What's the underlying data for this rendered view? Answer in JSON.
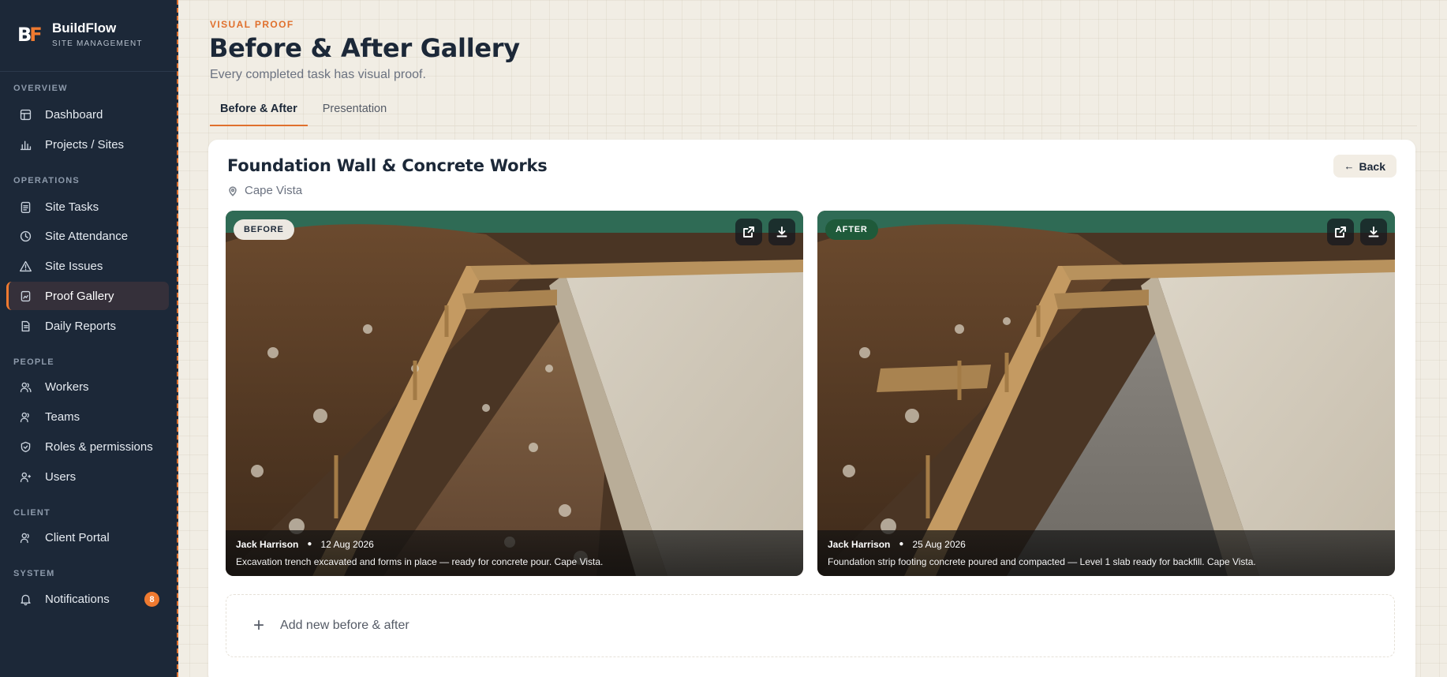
{
  "brand": {
    "logo_b": "B",
    "logo_f": "F",
    "name": "BuildFlow",
    "subtitle": "SITE MANAGEMENT"
  },
  "sidebar": {
    "sections": [
      {
        "title": "OVERVIEW"
      },
      {
        "title": "OPERATIONS"
      },
      {
        "title": "PEOPLE"
      },
      {
        "title": "CLIENT"
      },
      {
        "title": "SYSTEM"
      }
    ],
    "items": [
      {
        "label": "Dashboard",
        "icon": "dashboard-icon"
      },
      {
        "label": "Projects / Sites",
        "icon": "chart-icon"
      },
      {
        "label": "Site Tasks",
        "icon": "clipboard-icon"
      },
      {
        "label": "Site Attendance",
        "icon": "clock-icon"
      },
      {
        "label": "Site Issues",
        "icon": "warning-icon"
      },
      {
        "label": "Proof Gallery",
        "icon": "gallery-icon",
        "active": true
      },
      {
        "label": "Daily Reports",
        "icon": "report-icon"
      },
      {
        "label": "Workers",
        "icon": "users-icon"
      },
      {
        "label": "Teams",
        "icon": "team-icon"
      },
      {
        "label": "Roles & permissions",
        "icon": "shield-icon"
      },
      {
        "label": "Users",
        "icon": "user-icon"
      },
      {
        "label": "Client Portal",
        "icon": "client-icon"
      },
      {
        "label": "Notifications",
        "icon": "bell-icon",
        "badge": "8"
      }
    ]
  },
  "header": {
    "eyebrow": "VISUAL PROOF",
    "title": "Before & After Gallery",
    "subtitle": "Every completed task has visual proof."
  },
  "tabs": [
    {
      "label": "Before & After",
      "active": true
    },
    {
      "label": "Presentation",
      "active": false
    }
  ],
  "card": {
    "title": "Foundation Wall & Concrete Works",
    "location": "Cape Vista",
    "back_label": "Back",
    "before": {
      "tag": "BEFORE",
      "author": "Jack Harrison",
      "date": "12 Aug 2026",
      "caption": "Excavation trench excavated and forms in place — ready for concrete pour. Cape Vista."
    },
    "after": {
      "tag": "AFTER",
      "author": "Jack Harrison",
      "date": "25 Aug 2026",
      "caption": "Foundation strip footing concrete poured and compacted — Level 1 slab ready for backfill. Cape Vista."
    },
    "add_label": "Add new before & after"
  },
  "colors": {
    "accent": "#ef7a30",
    "sidebar": "#1c2838",
    "after_tag": "#1f5a3a"
  }
}
